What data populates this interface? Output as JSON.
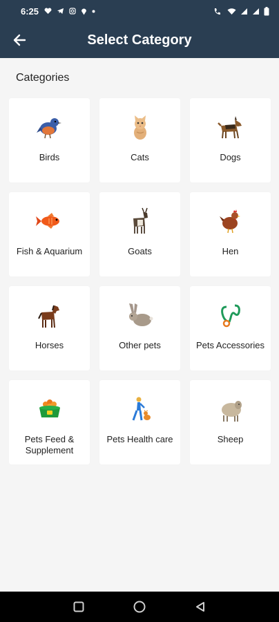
{
  "status": {
    "time": "6:25"
  },
  "appbar": {
    "title": "Select Category"
  },
  "section": {
    "title": "Categories"
  },
  "categories": [
    {
      "label": "Birds",
      "icon": "bird-icon"
    },
    {
      "label": "Cats",
      "icon": "cat-icon"
    },
    {
      "label": "Dogs",
      "icon": "dog-icon"
    },
    {
      "label": "Fish & Aquarium",
      "icon": "fish-icon"
    },
    {
      "label": "Goats",
      "icon": "goat-icon"
    },
    {
      "label": "Hen",
      "icon": "hen-icon"
    },
    {
      "label": "Horses",
      "icon": "horse-icon"
    },
    {
      "label": "Other pets",
      "icon": "rabbit-icon"
    },
    {
      "label": "Pets Accessories",
      "icon": "leash-icon"
    },
    {
      "label": "Pets Feed & Supplement",
      "icon": "pet-food-bowl-icon"
    },
    {
      "label": "Pets Health care",
      "icon": "pet-health-care-icon"
    },
    {
      "label": "Sheep",
      "icon": "sheep-icon"
    }
  ],
  "colors": {
    "header": "#2a3e52",
    "background": "#f5f5f5",
    "card": "#ffffff"
  }
}
